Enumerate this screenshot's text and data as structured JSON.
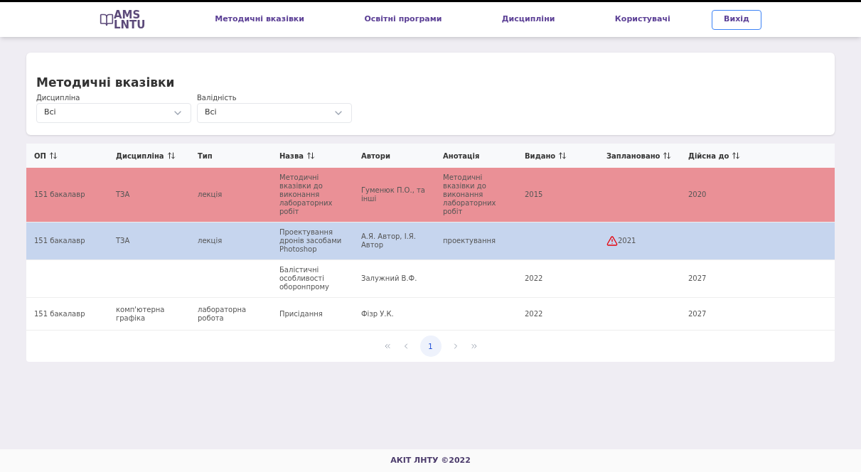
{
  "header": {
    "logo": {
      "top": "AMS",
      "bottom": "LNTU"
    },
    "nav": [
      "Методичні вказівки",
      "Освітні програми",
      "Дисципліни",
      "Користувачі"
    ],
    "logout": "Вихід"
  },
  "filters": {
    "title": "Методичні вказівки",
    "fields": [
      {
        "label": "Дисципліна",
        "value": "Всі"
      },
      {
        "label": "Валідність",
        "value": "Всі"
      }
    ]
  },
  "table": {
    "columns": [
      {
        "label": "ОП",
        "sortable": true
      },
      {
        "label": "Дисципліна",
        "sortable": true
      },
      {
        "label": "Тип",
        "sortable": false
      },
      {
        "label": "Назва",
        "sortable": true
      },
      {
        "label": "Автори",
        "sortable": false
      },
      {
        "label": "Анотація",
        "sortable": false
      },
      {
        "label": "Видано",
        "sortable": true
      },
      {
        "label": "Заплановано",
        "sortable": true
      },
      {
        "label": "Дійсна до",
        "sortable": true
      }
    ],
    "rows": [
      {
        "color": "#ea9096",
        "warning": false,
        "cells": [
          "151 бакалавр",
          "ТЗА",
          "лекція",
          "Методичні вказівки до виконання лабораторних робіт",
          "Гуменюк П.О., та інші",
          "Методичні вказівки до виконання лабораторних робіт",
          "2015",
          "",
          "2020"
        ]
      },
      {
        "color": "#c6d5ee",
        "warning": true,
        "cells": [
          "151 бакалавр",
          "ТЗА",
          "лекція",
          "Проектування дронів засобами Photoshop",
          "А.Я. Автор, І.Я. Автор",
          "проектування",
          "",
          "2021",
          ""
        ]
      },
      {
        "color": "#ffffff",
        "warning": false,
        "cells": [
          "",
          "",
          "",
          "Балістичні особливості оборонпрому",
          "Залужний В.Ф.",
          "",
          "2022",
          "",
          "2027"
        ]
      },
      {
        "color": "#ffffff",
        "warning": false,
        "cells": [
          "151 бакалавр",
          "комп'ютерна графіка",
          "лабораторна робота",
          "Присідання",
          "Фізр У.К.",
          "",
          "2022",
          "",
          "2027"
        ]
      }
    ]
  },
  "pagination": {
    "pages": [
      {
        "label": "1",
        "selected": true
      }
    ]
  },
  "footer": "АКІТ ЛНТУ ©2022"
}
